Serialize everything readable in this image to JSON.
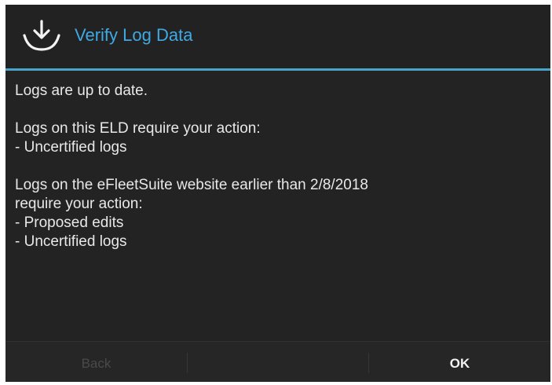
{
  "dialog": {
    "title": "Verify Log Data",
    "title_icon": "download-icon",
    "colors": {
      "accent": "#3fa9e4",
      "divider": "#4aa3c9",
      "background": "#232323",
      "text": "#e8e8e8"
    },
    "body": {
      "status": "Logs are up to date.",
      "eld_heading": "Logs on this ELD require your action:",
      "eld_items": [
        "- Uncertified logs"
      ],
      "website_heading_line1": "Logs on the eFleetSuite website earlier than 2/8/2018",
      "website_heading_line2": "require your action:",
      "website_items": [
        "- Proposed edits",
        "- Uncertified logs"
      ]
    },
    "buttons": {
      "back_label": "Back",
      "ok_label": "OK"
    }
  }
}
